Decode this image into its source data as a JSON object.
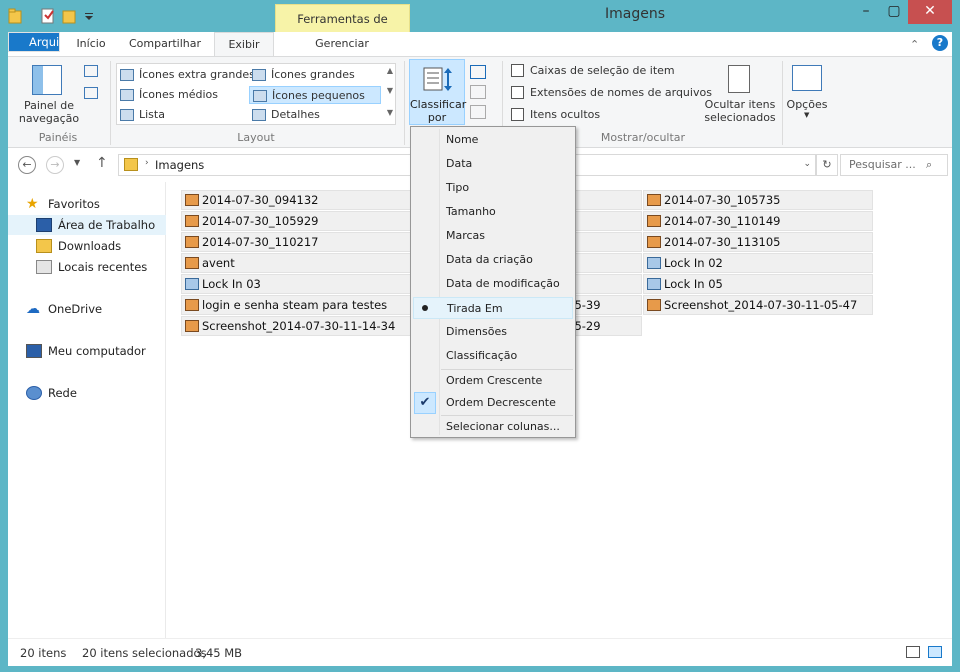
{
  "window": {
    "title": "Imagens",
    "context_tab": "Ferramentas de Imagem"
  },
  "tabs": {
    "file": "Arquivo",
    "home": "Início",
    "share": "Compartilhar",
    "view": "Exibir",
    "manage": "Gerenciar"
  },
  "ribbon": {
    "panes": {
      "nav_pane": "Painel de navegação",
      "group": "Painéis"
    },
    "layout": {
      "items": [
        "Ícones extra grandes",
        "Ícones grandes",
        "Ícones médios",
        "Ícones pequenos",
        "Lista",
        "Detalhes"
      ],
      "group": "Layout"
    },
    "sort": {
      "label": "Classificar por"
    },
    "show_hide": {
      "checkboxes": [
        "Caixas de seleção de item",
        "Extensões de nomes de arquivos",
        "Itens ocultos"
      ],
      "hide_selected": "Ocultar itens selecionados",
      "group": "Mostrar/ocultar"
    },
    "options": "Opções"
  },
  "address": {
    "crumb": "Imagens",
    "search_placeholder": "Pesquisar ..."
  },
  "nav": {
    "favorites": "Favoritos",
    "desktop": "Área de Trabalho",
    "downloads": "Downloads",
    "recent": "Locais recentes",
    "onedrive": "OneDrive",
    "computer": "Meu computador",
    "network": "Rede"
  },
  "files": {
    "c1": [
      "2014-07-30_094132",
      "2014-07-30_105929",
      "2014-07-30_110217",
      "avent",
      "Lock In 03",
      "login e senha steam para testes",
      "Screenshot_2014-07-30-11-14-34"
    ],
    "c2": [
      "-05-39",
      "-15-29"
    ],
    "c3": [
      "2014-07-30_105735",
      "2014-07-30_110149",
      "2014-07-30_113105",
      "Lock In 02",
      "Lock In 05",
      "Screenshot_2014-07-30-11-05-47"
    ]
  },
  "sort_menu": {
    "items": [
      "Nome",
      "Data",
      "Tipo",
      "Tamanho",
      "Marcas",
      "Data da criação",
      "Data de modificação",
      "Tirada Em",
      "Dimensões",
      "Classificação"
    ],
    "asc": "Ordem Crescente",
    "desc": "Ordem Decrescente",
    "columns": "Selecionar colunas..."
  },
  "status": {
    "count": "20 itens",
    "selected": "20 itens selecionados",
    "size": "3,45 MB"
  }
}
